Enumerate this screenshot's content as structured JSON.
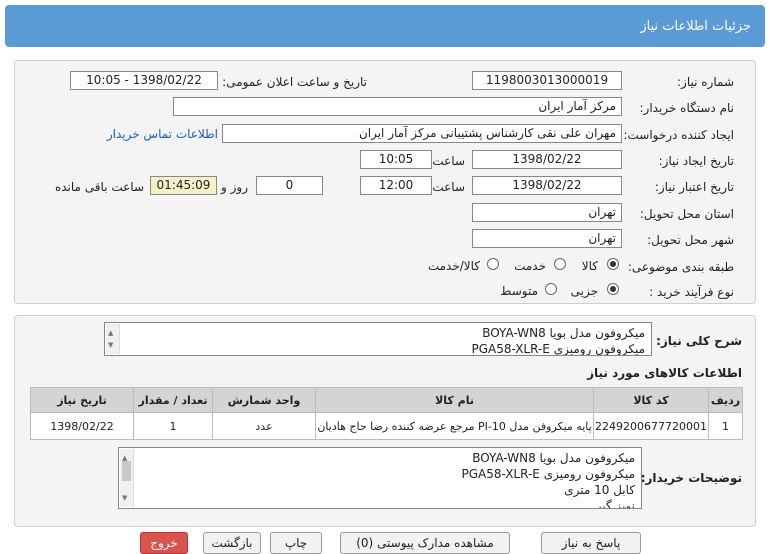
{
  "header": {
    "title": "جزئیات اطلاعات نیاز"
  },
  "form": {
    "need_number_label": "شماره نیاز:",
    "need_number": "1198003013000019",
    "announce_label": "تاریخ و ساعت اعلان عمومی:",
    "announce_value": "1398/02/22 - 10:05",
    "buyer_org_label": "نام دستگاه خریدار:",
    "buyer_org": "مرکز آمار ایران",
    "creator_label": "ایجاد کننده درخواست:",
    "creator": "مهران  علی نقی کارشناس پشتیبانی مرکز آمار ایران",
    "contact_link": "اطلاعات تماس خریدار",
    "created_label": "تاریخ ایجاد نیاز:",
    "created_date": "1398/02/22",
    "created_time": "10:05",
    "time_label": "ساعت",
    "valid_label": "تاریخ اعتبار نیاز:",
    "valid_date": "1398/02/22",
    "valid_time": "12:00",
    "days_value": "0",
    "day_label": "روز و",
    "remaining_time": "01:45:09",
    "remaining_label": "ساعت باقی مانده",
    "province_label": "استان محل تحویل:",
    "province": "تهران",
    "city_label": "شهر محل تحویل:",
    "city": "تهران",
    "category_label": "طبقه بندی موضوعی:",
    "category_options": [
      "کالا",
      "خدمت",
      "کالا/خدمت"
    ],
    "category_selected": "کالا",
    "process_label": "نوع فرآیند خرید :",
    "process_options": [
      "جزیی",
      "متوسط"
    ],
    "process_selected": "جزیی"
  },
  "summary": {
    "label": "شرح کلی نیاز:",
    "lines": [
      "میکروفون مدل بویا BOYA-WN8",
      "میکروفون رومیزی PGA58-XLR-E"
    ]
  },
  "items": {
    "section_title": "اطلاعات کالاهای مورد نیاز",
    "columns": [
      "ردیف",
      "کد کالا",
      "نام کالا",
      "واحد شمارش",
      "تعداد / مقدار",
      "تاریخ نیاز"
    ],
    "rows": [
      [
        "1",
        "2249200677720001",
        "پایه میکروفن مدل PI-10 مرجع عرضه کننده رضا حاج هادیان",
        "عدد",
        "1",
        "1398/02/22"
      ]
    ]
  },
  "notes": {
    "label": "توضیحات خریدار:",
    "lines": [
      "میکروفون مدل بویا BOYA-WN8",
      "میکروفون رومیزی PGA58-XLR-E",
      "کابل 10 متری",
      "نویز گیر"
    ]
  },
  "buttons": {
    "reply": "پاسخ به نیاز",
    "view_docs": "مشاهده مدارک پیوستی (0)",
    "print": "چاپ",
    "back": "بازگشت",
    "exit": "خروج"
  }
}
